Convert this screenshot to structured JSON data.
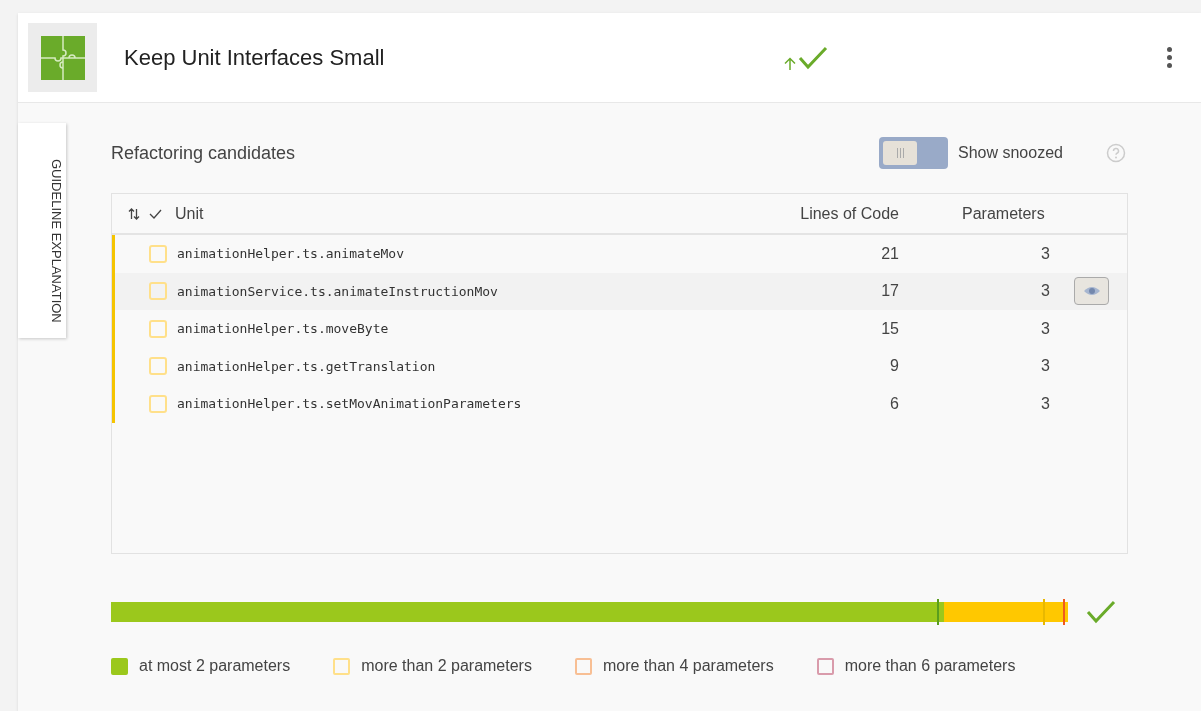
{
  "header": {
    "title": "Keep Unit Interfaces Small",
    "passed": true,
    "trend_up": true
  },
  "side_tab": {
    "label": "GUIDELINE EXPLANATION"
  },
  "section": {
    "title": "Refactoring candidates",
    "toggle": {
      "label": "Show snoozed",
      "on": false
    }
  },
  "table": {
    "columns": [
      "Unit",
      "Lines of Code",
      "Parameters"
    ],
    "rows": [
      {
        "unit": "animationHelper.ts.animateMov",
        "lines": "21",
        "parameters": "3",
        "color": "#f5c400",
        "checked": false,
        "hovered": false
      },
      {
        "unit": "animationService.ts.animateInstructionMov",
        "lines": "17",
        "parameters": "3",
        "color": "#f5c400",
        "checked": false,
        "hovered": true
      },
      {
        "unit": "animationHelper.ts.moveByte",
        "lines": "15",
        "parameters": "3",
        "color": "#f5c400",
        "checked": false,
        "hovered": false
      },
      {
        "unit": "animationHelper.ts.getTranslation",
        "lines": "9",
        "parameters": "3",
        "color": "#f5c400",
        "checked": false,
        "hovered": false
      },
      {
        "unit": "animationHelper.ts.setMovAnimationParameters",
        "lines": "6",
        "parameters": "3",
        "color": "#f5c400",
        "checked": false,
        "hovered": false
      }
    ]
  },
  "distribution": {
    "passed": true,
    "fill": {
      "level": 0.87,
      "color": "#9bc81c"
    },
    "track": {
      "color": "#ffc800"
    },
    "markers": [
      {
        "color": "#5a9e1e"
      },
      {
        "color": "#e8b800"
      },
      {
        "color": "#f05a1e"
      }
    ]
  },
  "legend": [
    {
      "label": "at most 2 parameters",
      "color": "#9bc81c",
      "filled": true
    },
    {
      "label": "more than 2 parameters",
      "color": "#ffe08a",
      "filled": false
    },
    {
      "label": "more than 4 parameters",
      "color": "#f8bf94",
      "filled": false
    },
    {
      "label": "more than 6 parameters",
      "color": "#d99bab",
      "filled": false
    }
  ]
}
